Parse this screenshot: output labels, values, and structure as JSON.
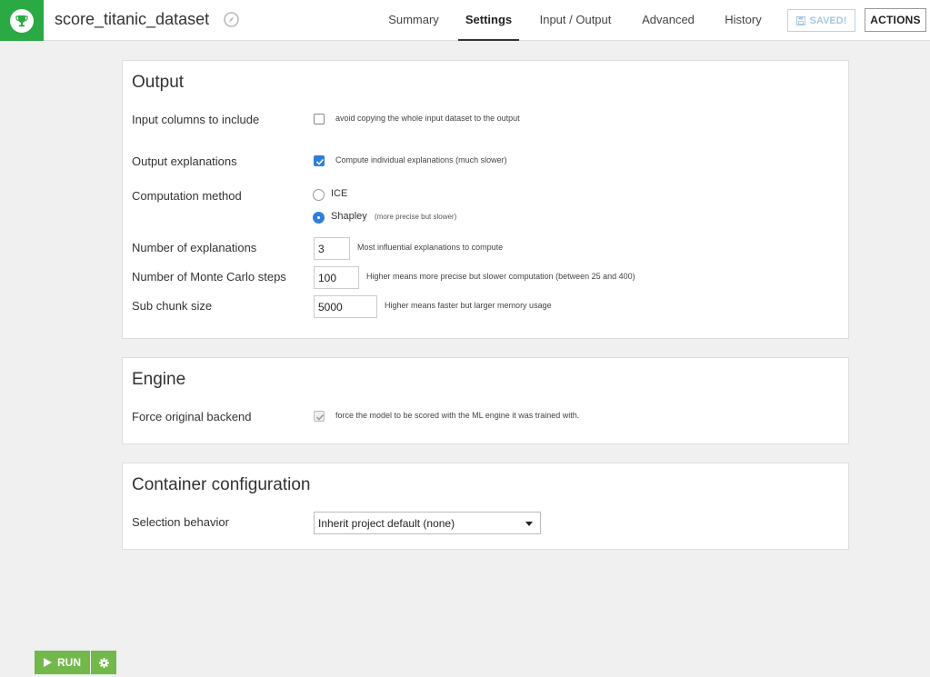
{
  "header": {
    "recipe_name": "score_titanic_dataset",
    "tabs": [
      {
        "label": "Summary",
        "active": false
      },
      {
        "label": "Settings",
        "active": true
      },
      {
        "label": "Input / Output",
        "active": false
      },
      {
        "label": "Advanced",
        "active": false
      },
      {
        "label": "History",
        "active": false
      }
    ],
    "saved_label": "SAVED!",
    "actions_label": "ACTIONS"
  },
  "output": {
    "title": "Output",
    "input_columns": {
      "label": "Input columns to include",
      "checkbox_text": "avoid copying the whole input dataset to the output",
      "checked": false
    },
    "output_explanations": {
      "label": "Output explanations",
      "checkbox_text": "Compute individual explanations (much slower)",
      "checked": true
    },
    "computation_method": {
      "label": "Computation method",
      "options": [
        {
          "label": "ICE",
          "note": "",
          "selected": false
        },
        {
          "label": "Shapley",
          "note": "(more precise but slower)",
          "selected": true
        }
      ]
    },
    "num_explanations": {
      "label": "Number of explanations",
      "value": "3",
      "hint": "Most influential explanations to compute"
    },
    "monte_carlo": {
      "label": "Number of Monte Carlo steps",
      "value": "100",
      "hint": "Higher means more precise but slower computation (between 25 and 400)"
    },
    "sub_chunk": {
      "label": "Sub chunk size",
      "value": "5000",
      "hint": "Higher means faster but larger memory usage"
    }
  },
  "engine": {
    "title": "Engine",
    "force_backend": {
      "label": "Force original backend",
      "checkbox_text": "force the model to be scored with the ML engine it was trained with.",
      "checked": true
    }
  },
  "container": {
    "title": "Container configuration",
    "selection": {
      "label": "Selection behavior",
      "value": "Inherit project default (none)"
    }
  },
  "run": {
    "label": "RUN"
  },
  "colors": {
    "brand_green": "#2aa944",
    "run_green": "#72b84b",
    "accent_blue": "#2f7fd9"
  }
}
